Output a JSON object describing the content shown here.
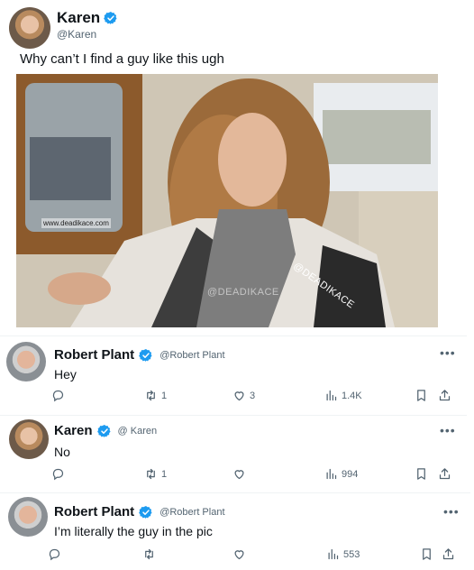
{
  "main": {
    "name": "Karen",
    "handle": "@Karen",
    "text": "Why can’t I find a guy like this ugh",
    "watermarks": {
      "url": "www.deadikace.com",
      "diag": "@DEADIKACE",
      "center": "@DEADIKACE"
    }
  },
  "replies": [
    {
      "name": "Robert Plant",
      "handle": "@Robert Plant",
      "text": "Hey",
      "retweets": "1",
      "likes": "3",
      "views": "1.4K",
      "more": "•••"
    },
    {
      "name": "Karen",
      "handle": "@ Karen",
      "text": "No",
      "retweets": "1",
      "likes": "",
      "views": "994",
      "more": "•••"
    },
    {
      "name": "Robert Plant",
      "handle": "@Robert Plant",
      "text": "I’m literally the guy in the pic",
      "retweets": "",
      "likes": "",
      "views": "553",
      "more": "•••"
    }
  ],
  "colors": {
    "verified": "#1d9bf0",
    "muted": "#536471",
    "text": "#0f1419"
  },
  "icons": [
    "verified-badge-icon",
    "reply-icon",
    "retweet-icon",
    "like-icon",
    "views-icon",
    "bookmark-icon",
    "share-icon",
    "more-icon"
  ]
}
